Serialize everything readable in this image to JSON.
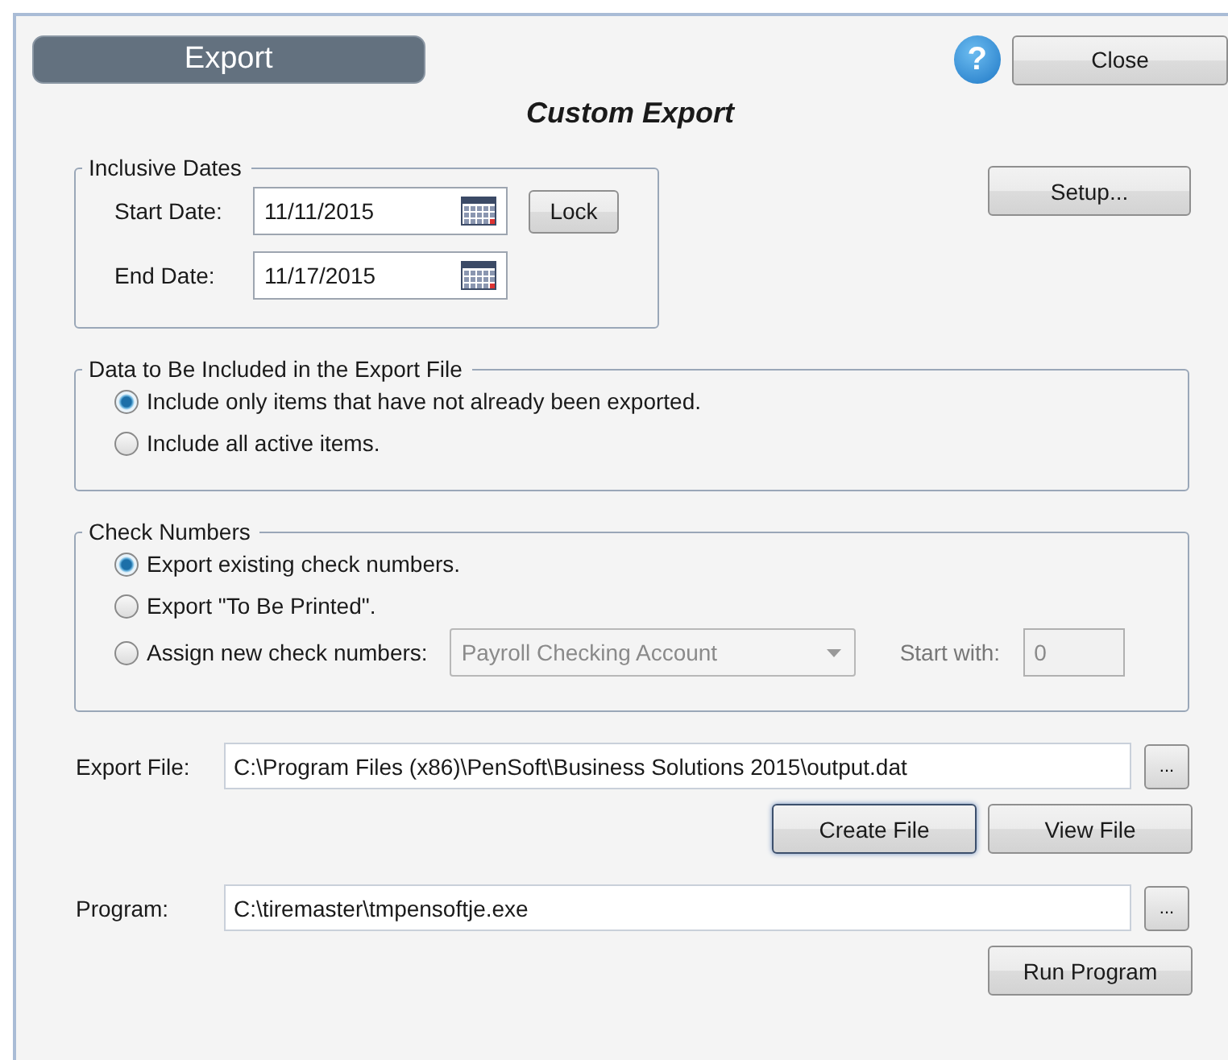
{
  "header": {
    "title": "Export"
  },
  "help": {
    "label": "?"
  },
  "close_button": {
    "label": "Close"
  },
  "title": "Custom Export",
  "setup_button": {
    "label": "Setup..."
  },
  "inclusive_dates": {
    "legend": "Inclusive Dates",
    "start": {
      "label": "Start Date:",
      "value": "11/11/2015"
    },
    "end": {
      "label": "End Date:",
      "value": "11/17/2015"
    },
    "lock_button": {
      "label": "Lock"
    }
  },
  "data_included": {
    "legend": "Data to Be Included in the Export File",
    "options": [
      {
        "label": "Include only items that have not already been exported.",
        "selected": true
      },
      {
        "label": "Include all active items.",
        "selected": false
      }
    ]
  },
  "check_numbers": {
    "legend": "Check Numbers",
    "options": [
      {
        "label": "Export existing check numbers.",
        "selected": true
      },
      {
        "label": "Export \"To Be Printed\".",
        "selected": false
      },
      {
        "label": "Assign new check numbers:",
        "selected": false
      }
    ],
    "account": {
      "value": "Payroll Checking Account",
      "disabled": true
    },
    "start_with": {
      "label": "Start with:",
      "value": "0",
      "disabled": true
    }
  },
  "export_file": {
    "label": "Export File:",
    "value": "C:\\Program Files (x86)\\PenSoft\\Business Solutions 2015\\output.dat",
    "browse": "...",
    "buttons": [
      {
        "label": "Create File",
        "focused": true
      },
      {
        "label": "View File",
        "focused": false
      }
    ]
  },
  "program": {
    "label": "Program:",
    "value": "C:\\tiremaster\\tmpensoftje.exe",
    "browse": "...",
    "buttons": [
      {
        "label": "Run Program",
        "focused": false
      }
    ]
  }
}
